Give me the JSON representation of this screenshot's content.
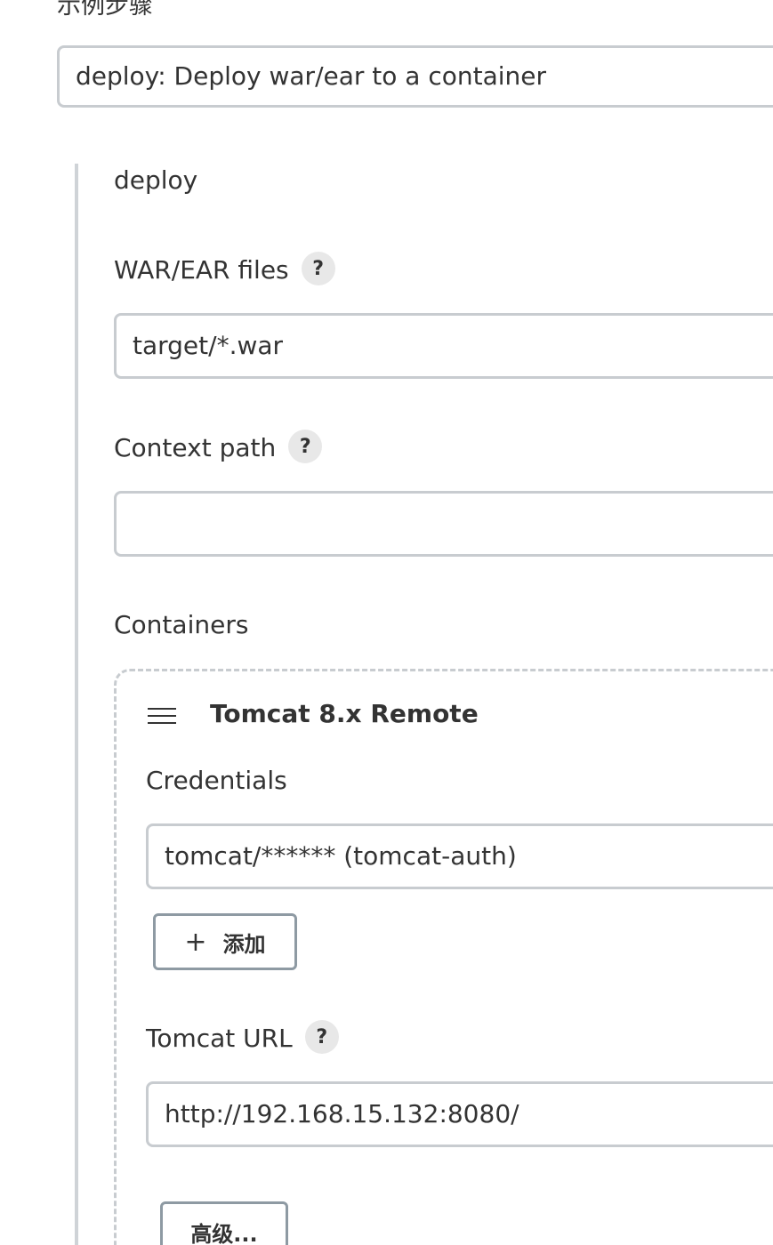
{
  "step_section": {
    "label": "示例步骤",
    "selected_step": "deploy: Deploy war/ear to a container"
  },
  "deploy": {
    "heading": "deploy",
    "war_ear_files": {
      "label": "WAR/EAR files",
      "help": "?",
      "value": "target/*.war"
    },
    "context_path": {
      "label": "Context path",
      "help": "?",
      "value": ""
    },
    "containers": {
      "label": "Containers",
      "items": [
        {
          "title": "Tomcat 8.x Remote",
          "drag_icon": "hamburger-icon",
          "credentials_label": "Credentials",
          "credentials_value": "tomcat/****** (tomcat-auth)",
          "add_button": "添加",
          "add_icon": "plus-icon",
          "tomcat_url_label": "Tomcat URL",
          "tomcat_url_help": "?",
          "tomcat_url_value": "http://192.168.15.132:8080/",
          "advanced_button": "高级..."
        }
      ]
    }
  }
}
